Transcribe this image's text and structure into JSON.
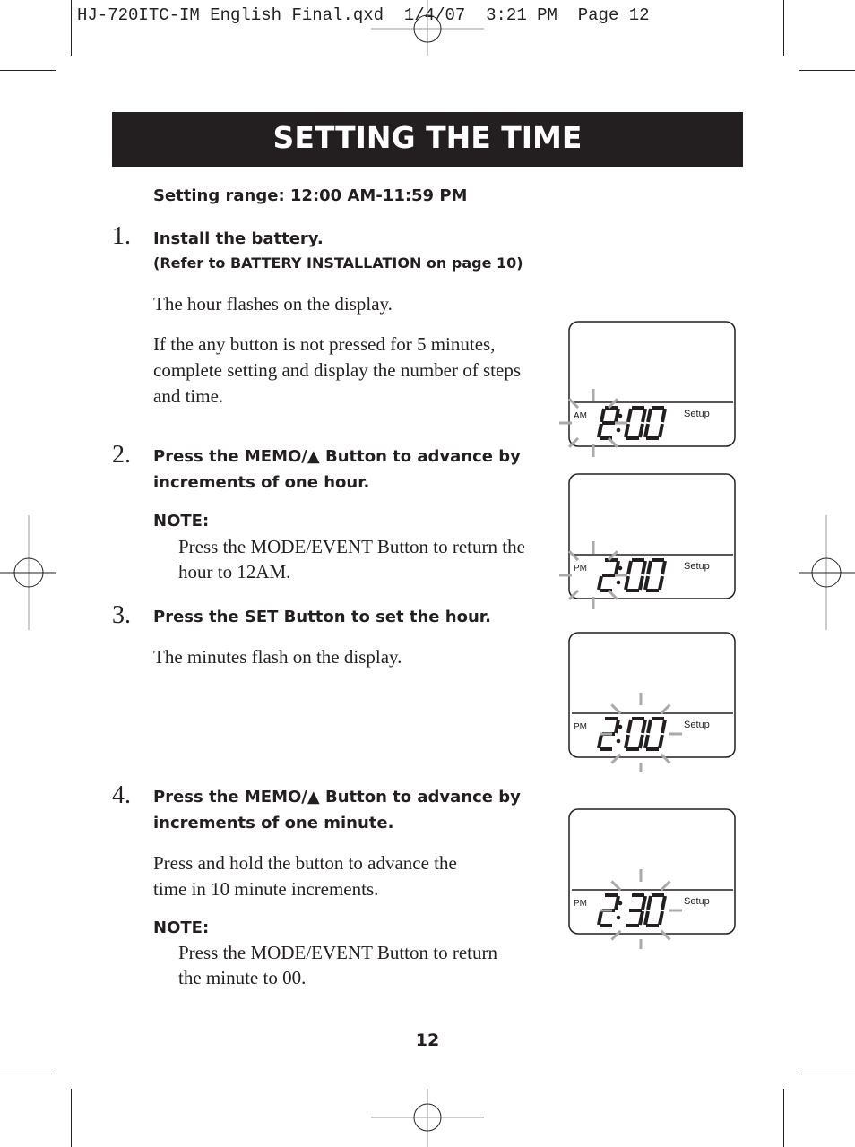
{
  "slug": {
    "file": "HJ-720ITC-IM English Final.qxd",
    "date": "1/4/07",
    "time": "3:21 PM",
    "page_label": "Page 12"
  },
  "title": "SETTING THE TIME",
  "setting_range": "Setting range: 12:00 AM-11:59 PM",
  "steps": [
    {
      "number": "1.",
      "title": "Install the battery.",
      "subtitle": "(Refer to BATTERY INSTALLATION on page 10)",
      "paragraphs": [
        "The hour flashes on the display.",
        "If the any button is not pressed for 5 minutes, complete setting and display the number of steps and time."
      ]
    },
    {
      "number": "2.",
      "title": "Press the MEMO/▲ Button to advance by increments of one hour.",
      "note_label": "NOTE:",
      "note_text": "Press the MODE/EVENT Button to return the hour to 12AM."
    },
    {
      "number": "3.",
      "title": "Press the SET Button to set the hour.",
      "paragraphs": [
        "The minutes flash on the display."
      ]
    },
    {
      "number": "4.",
      "title": "Press the MEMO/▲ Button to advance by increments of one minute.",
      "paragraphs": [
        "Press and hold the button to advance the time in 10 minute increments."
      ],
      "note_label": "NOTE:",
      "note_text": "Press the MODE/EVENT Button to return the minute to 00."
    }
  ],
  "displays": [
    {
      "meridiem": "AM",
      "hour": "12",
      "minute": "00",
      "mode_label": "Setup",
      "flashing": "hour"
    },
    {
      "meridiem": "PM",
      "hour": "2",
      "minute": "00",
      "mode_label": "Setup",
      "flashing": "hour"
    },
    {
      "meridiem": "PM",
      "hour": "2",
      "minute": "00",
      "mode_label": "Setup",
      "flashing": "minute"
    },
    {
      "meridiem": "PM",
      "hour": "2",
      "minute": "30",
      "mode_label": "Setup",
      "flashing": "minute"
    }
  ],
  "page_number": "12"
}
